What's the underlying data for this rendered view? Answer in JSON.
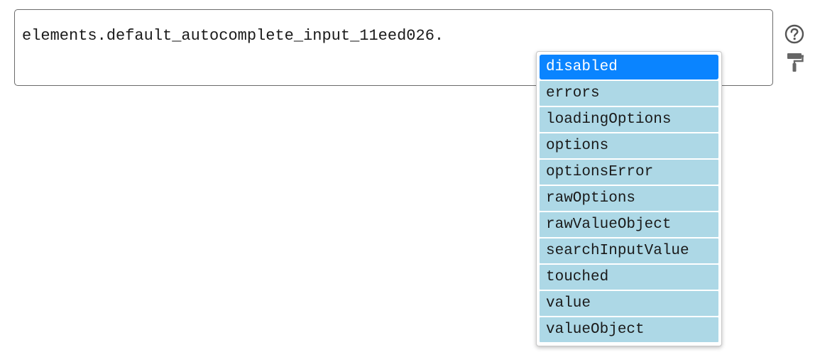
{
  "editor": {
    "code": "elements.default_autocomplete_input_11eed026."
  },
  "icons": {
    "help": "question-circle-icon",
    "format": "paint-roller-icon"
  },
  "autocomplete": {
    "selected_index": 0,
    "items": [
      "disabled",
      "errors",
      "loadingOptions",
      "options",
      "optionsError",
      "rawOptions",
      "rawValueObject",
      "searchInputValue",
      "touched",
      "value",
      "valueObject"
    ],
    "colors": {
      "item_bg": "#add8e6",
      "selected_bg": "#0a84ff",
      "selected_text": "#ffffff"
    }
  }
}
